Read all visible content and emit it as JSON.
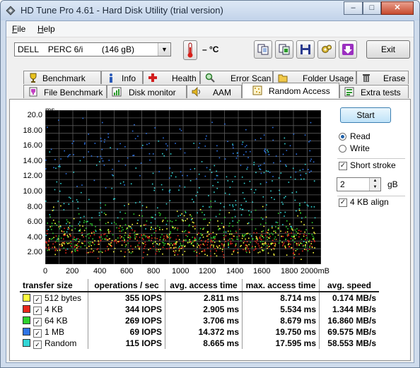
{
  "window": {
    "title": "HD Tune Pro 4.61 - Hard Disk Utility (trial version)",
    "caption_buttons": [
      "–",
      "□",
      "✕"
    ]
  },
  "menu": [
    {
      "label": "File",
      "mnemonic": "F",
      "rest": "ile"
    },
    {
      "label": "Help",
      "mnemonic": "H",
      "rest": "elp"
    }
  ],
  "toolbar": {
    "drive": "DELL    PERC 6/i        (146 gB)",
    "temperature": "– °C",
    "exit_label": "Exit",
    "icons": [
      "copy-text-icon",
      "copy-screenshot-icon",
      "save-icon",
      "options-icon",
      "download-icon"
    ]
  },
  "tabs_row1": [
    {
      "label": "Benchmark",
      "icon": "benchmark-icon"
    },
    {
      "label": "Info",
      "icon": "info-icon"
    },
    {
      "label": "Health",
      "icon": "health-icon"
    },
    {
      "label": "Error Scan",
      "icon": "error-scan-icon"
    },
    {
      "label": "Folder Usage",
      "icon": "folder-icon"
    },
    {
      "label": "Erase",
      "icon": "trash-icon"
    }
  ],
  "tabs_row2": [
    {
      "label": "File Benchmark",
      "icon": "file-benchmark-icon"
    },
    {
      "label": "Disk monitor",
      "icon": "disk-monitor-icon"
    },
    {
      "label": "AAM",
      "icon": "speaker-icon"
    },
    {
      "label": "Random Access",
      "icon": "random-access-icon",
      "active": true
    },
    {
      "label": "Extra tests",
      "icon": "extra-tests-icon"
    }
  ],
  "controls": {
    "start_label": "Start",
    "read_label": "Read",
    "write_label": "Write",
    "mode_selected": "Read",
    "short_stroke_label": "Short stroke",
    "short_stroke_checked": true,
    "short_stroke_value": "2",
    "short_stroke_unit": "gB",
    "align_label": "4 KB align",
    "align_checked": true
  },
  "chart_data": {
    "type": "scatter",
    "ylabel": "ms",
    "xlabel": "",
    "xlim": [
      0,
      2000
    ],
    "ylim": [
      0,
      20
    ],
    "x_ticks": [
      "0",
      "200",
      "400",
      "600",
      "800",
      "1000",
      "1200",
      "1400",
      "1600",
      "1800",
      "2000mB"
    ],
    "y_ticks": [
      "20.0",
      "18.00",
      "16.00",
      "14.00",
      "12.00",
      "10.00",
      "8.00",
      "6.00",
      "4.00",
      "2.00"
    ],
    "grid": true,
    "background": "#000000",
    "series": [
      {
        "name": "512 bytes",
        "color": "#ffff3c",
        "min_ms": 0.5,
        "max_ms": 8.714,
        "mean_ms": 2.811
      },
      {
        "name": "4 KB",
        "color": "#e8281c",
        "min_ms": 0.5,
        "max_ms": 5.534,
        "mean_ms": 2.905
      },
      {
        "name": "64 KB",
        "color": "#2ed12e",
        "min_ms": 0.8,
        "max_ms": 8.679,
        "mean_ms": 3.706
      },
      {
        "name": "1 MB",
        "color": "#2f74e6",
        "min_ms": 8.0,
        "max_ms": 19.75,
        "mean_ms": 14.372
      },
      {
        "name": "Random",
        "color": "#33d6d6",
        "min_ms": 1.0,
        "max_ms": 17.595,
        "mean_ms": 8.665
      }
    ]
  },
  "results": {
    "headers": [
      "transfer size",
      "operations / sec",
      "avg. access time",
      "max. access time",
      "avg. speed"
    ],
    "rows": [
      {
        "label": "512 bytes",
        "color": "#ffff3c",
        "iops": "355 IOPS",
        "avg": "2.811 ms",
        "max": "8.714 ms",
        "speed": "0.174 MB/s"
      },
      {
        "label": "4 KB",
        "color": "#e8281c",
        "iops": "344 IOPS",
        "avg": "2.905 ms",
        "max": "5.534 ms",
        "speed": "1.344 MB/s"
      },
      {
        "label": "64 KB",
        "color": "#2ed12e",
        "iops": "269 IOPS",
        "avg": "3.706 ms",
        "max": "8.679 ms",
        "speed": "16.860 MB/s"
      },
      {
        "label": "1 MB",
        "color": "#2f74e6",
        "iops": "69 IOPS",
        "avg": "14.372 ms",
        "max": "19.750 ms",
        "speed": "69.575 MB/s"
      },
      {
        "label": "Random",
        "color": "#33d6d6",
        "iops": "115 IOPS",
        "avg": "8.665 ms",
        "max": "17.595 ms",
        "speed": "58.553 MB/s"
      }
    ]
  }
}
